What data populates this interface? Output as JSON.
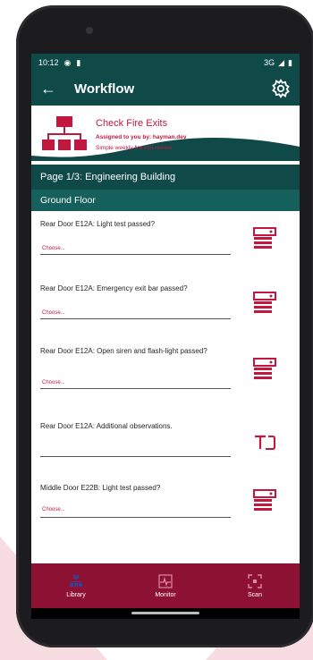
{
  "status_bar": {
    "time": "10:12",
    "network": "3G"
  },
  "app_bar": {
    "title": "Workflow"
  },
  "workflow": {
    "title": "Check Fire Exits",
    "assigned": "Assigned to you by: hayman.dev",
    "description": "Simple weekly fire exit review."
  },
  "page_title": "Page 1/3: Engineering Building",
  "section_title": "Ground Floor",
  "questions": [
    {
      "label": "Rear Door E12A: Light test passed?",
      "placeholder": "Choose...",
      "icon": "checklist-icon"
    },
    {
      "label": "Rear Door E12A: Emergency exit bar passed?",
      "placeholder": "Choose...",
      "icon": "checklist-icon"
    },
    {
      "label": "Rear Door E12A: Open siren and flash-light passed?",
      "placeholder": "Choose...",
      "icon": "checklist-icon"
    },
    {
      "label": "Rear Door E12A: Additional observations.",
      "placeholder": "",
      "icon": "text-field-icon"
    },
    {
      "label": "Middle Door E22B: Light test passed?",
      "placeholder": "Choose...",
      "icon": "checklist-icon"
    }
  ],
  "bottom_nav": {
    "items": [
      {
        "label": "Library",
        "icon": "library-icon"
      },
      {
        "label": "Monitor",
        "icon": "monitor-icon"
      },
      {
        "label": "Scan",
        "icon": "scan-icon"
      }
    ]
  },
  "colors": {
    "primary": "#0f4a49",
    "accent": "#c2183f",
    "nav": "#8c1133"
  }
}
